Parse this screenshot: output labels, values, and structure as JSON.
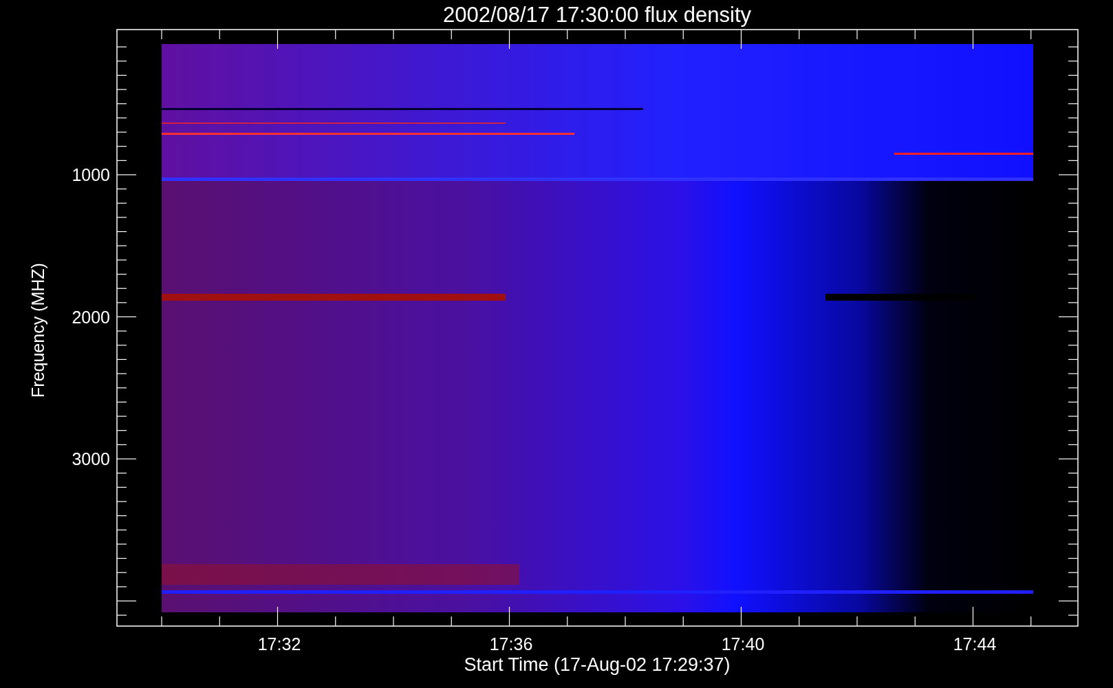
{
  "title": "2002/08/17 17:30:00 flux density",
  "y_axis": {
    "label": "Frequency (MHZ)",
    "ticks": [
      "1000",
      "2000",
      "3000"
    ]
  },
  "x_axis": {
    "label": "Start Time (17-Aug-02 17:29:37)",
    "ticks": [
      "17:32",
      "17:36",
      "17:40",
      "17:44"
    ]
  }
}
